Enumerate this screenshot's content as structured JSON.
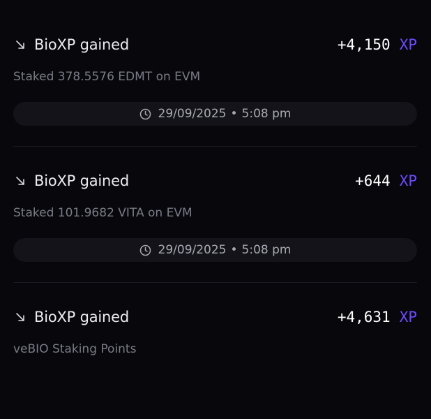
{
  "activity": {
    "entries": [
      {
        "icon": "arrow-down-right-icon",
        "title": "BioXP gained",
        "amount": "+4,150",
        "unit": "XP",
        "description": "Staked 378.5576 EDMT on EVM",
        "date": "29/09/2025",
        "separator": "•",
        "time": "5:08 pm"
      },
      {
        "icon": "arrow-down-right-icon",
        "title": "BioXP gained",
        "amount": "+644",
        "unit": "XP",
        "description": "Staked 101.9682 VITA on EVM",
        "date": "29/09/2025",
        "separator": "•",
        "time": "5:08 pm"
      },
      {
        "icon": "arrow-down-right-icon",
        "title": "BioXP gained",
        "amount": "+4,631",
        "unit": "XP",
        "description": "veBIO Staking Points"
      }
    ]
  },
  "colors": {
    "background": "#07070c",
    "accent_xp": "#6b4cff",
    "pill_background": "#131319",
    "muted_text": "#7b7b86"
  }
}
